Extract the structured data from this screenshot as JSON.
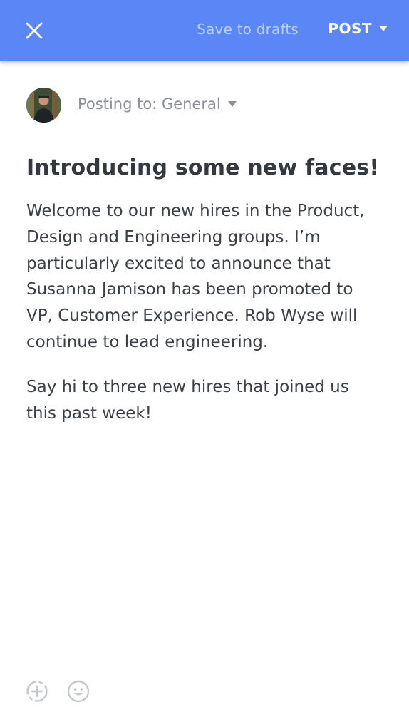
{
  "header": {
    "close_icon": "close-icon",
    "save_label": "Save to drafts",
    "post_label": "POST"
  },
  "composer": {
    "posting_to_label": "Posting to: General",
    "title": "Introducing some new faces!",
    "paragraphs": [
      "Welcome to our new hires in the Product, Design and Engineering groups. I’m particularly excited to announce that Susanna Jamison has been promoted to VP, Customer Experience. Rob Wyse will continue to lead engineering.",
      "Say hi to three new hires that joined us this past week!"
    ]
  },
  "toolbar": {
    "icons": [
      "add-attachment-icon",
      "emoji-icon"
    ]
  },
  "colors": {
    "header_bg": "#5b86f5",
    "title": "#33393f",
    "body_text": "#3c4148",
    "muted": "#8c9097"
  }
}
